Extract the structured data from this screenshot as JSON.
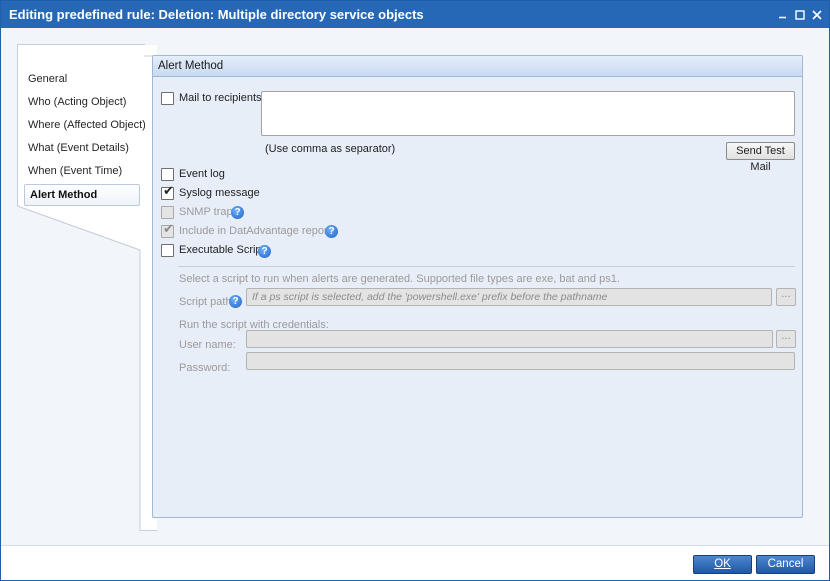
{
  "window": {
    "title": "Editing predefined rule: Deletion: Multiple directory service objects",
    "controls": [
      "minimize",
      "maximize",
      "close"
    ]
  },
  "nav": {
    "items": [
      {
        "label": "General"
      },
      {
        "label": "Who (Acting Object)"
      },
      {
        "label": "Where (Affected Object)"
      },
      {
        "label": "What (Event Details)"
      },
      {
        "label": "When (Event Time)"
      },
      {
        "label": "Alert Method"
      }
    ],
    "active": "Alert Method"
  },
  "panel": {
    "header": "Alert Method",
    "mail": {
      "label": "Mail to recipients:",
      "checked": false,
      "value": "",
      "hint": "(Use comma as separator)",
      "send_test_label": "Send Test Mail"
    },
    "options": [
      {
        "label": "Event log",
        "checked": false,
        "disabled": false,
        "help": false
      },
      {
        "label": "Syslog message",
        "checked": true,
        "disabled": false,
        "help": false
      },
      {
        "label": "SNMP trap",
        "checked": false,
        "disabled": true,
        "help": true
      },
      {
        "label": "Include in DatAdvantage reports",
        "checked": true,
        "disabled": true,
        "help": true
      },
      {
        "label": "Executable Script",
        "checked": false,
        "disabled": false,
        "help": true
      }
    ],
    "script": {
      "description": "Select a script to run when alerts are generated. Supported file types are exe, bat and ps1.",
      "path_label": "Script path",
      "path_placeholder": "If a ps script is selected, add the 'powershell.exe' prefix before the pathname",
      "browse_label": "...",
      "credentials_label": "Run the script with credentials:",
      "username_label": "User name:",
      "password_label": "Password:",
      "username_value": "",
      "password_value": ""
    }
  },
  "footer": {
    "ok_label": "OK",
    "cancel_label": "Cancel"
  },
  "colors": {
    "titlebar": "#2668b5",
    "accent": "#1f58a5"
  },
  "icons": {
    "check": "checkmark-icon",
    "help": "help-icon"
  }
}
